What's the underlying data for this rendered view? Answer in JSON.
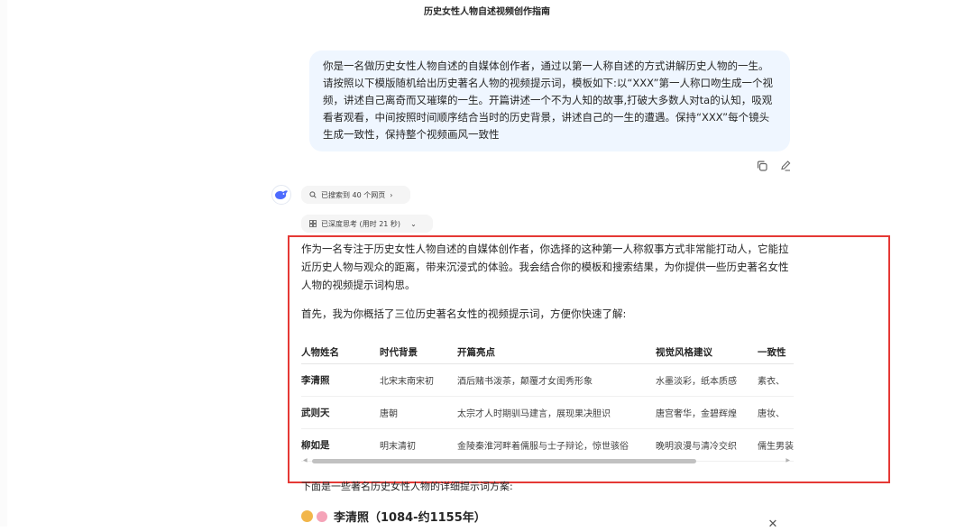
{
  "header": {
    "title": "历史女性人物自述视频创作指南"
  },
  "user_message": {
    "text": "你是一名做历史女性人物自述的自媒体创作者，通过以第一人称自述的方式讲解历史人物的一生。请按照以下模版随机给出历史著名人物的视频提示词，模板如下:以“XXX”第一人称口吻生成一个视频，讲述自己离奇而又璀璨的一生。开篇讲述一个不为人知的故事,打破大多数人对ta的认知，吸观看者观看，中间按照时间顺序结合当时的历史背景，讲述自己的一生的遭遇。保持“XXX”每个镜头生成一致性，保持整个视频画风一致性"
  },
  "search_pill": {
    "label": "已搜索到 40 个网页"
  },
  "think_pill": {
    "label": "已深度思考 (用时 21 秒)"
  },
  "answer": {
    "intro": "作为一名专注于历史女性人物自述的自媒体创作者，你选择的这种第一人称叙事方式非常能打动人，它能拉近历史人物与观众的距离，带来沉浸式的体验。我会结合你的模板和搜索结果，为你提供一些历史著名女性人物的视频提示词构思。",
    "summary_intro": "首先，我为你概括了三位历史著名女性的视频提示词，方便你快速了解:",
    "table": {
      "headers": [
        "人物姓名",
        "时代背景",
        "开篇亮点",
        "视觉风格建议",
        "一致性"
      ],
      "rows": [
        [
          "李清照",
          "北宋末南宋初",
          "酒后赌书泼茶，颠覆才女闺秀形象",
          "水墨淡彩，纸本质感",
          "素衣、"
        ],
        [
          "武则天",
          "唐朝",
          "太宗才人时期驯马建言，展现果决胆识",
          "唐宫奢华，金碧辉煌",
          "唐妆、"
        ],
        [
          "柳如是",
          "明末清初",
          "金陵秦淮河畔着儒服与士子辩论，惊世骇俗",
          "晚明浪漫与清冷交织",
          "儒生男装"
        ]
      ]
    },
    "detail_intro": "下面是一些著名历史女性人物的详细提示词方案:",
    "first_heading": "李清照（1084-约1155年）"
  }
}
